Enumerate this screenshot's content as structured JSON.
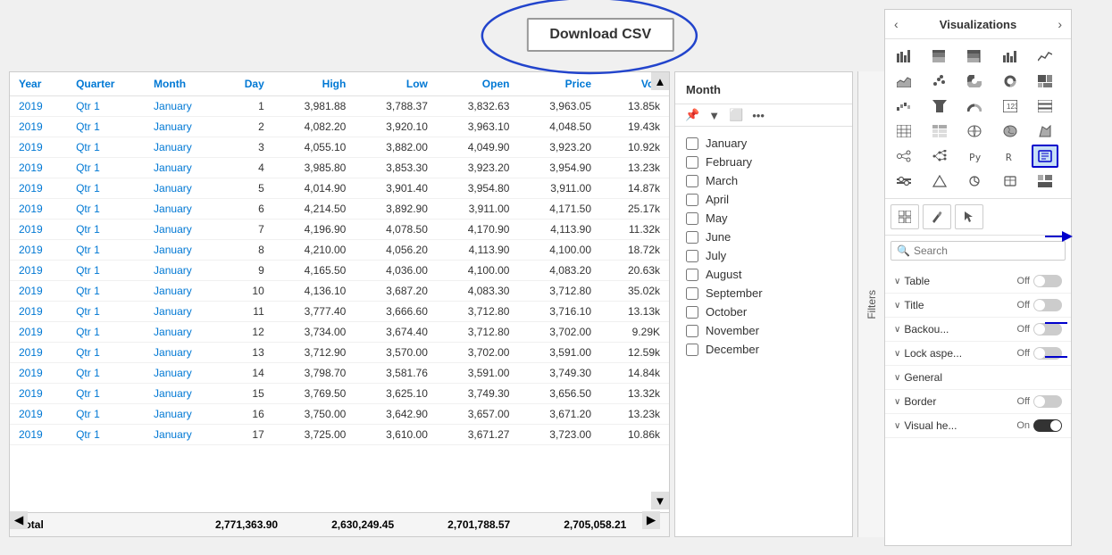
{
  "header": {
    "download_csv": "Download CSV"
  },
  "table": {
    "columns": [
      "Year",
      "Quarter",
      "Month",
      "Day",
      "High",
      "Low",
      "Open",
      "Price",
      "Vol."
    ],
    "rows": [
      [
        "2019",
        "Qtr 1",
        "January",
        "1",
        "3,981.88",
        "3,788.37",
        "3,832.63",
        "3,963.05",
        "13.85k"
      ],
      [
        "2019",
        "Qtr 1",
        "January",
        "2",
        "4,082.20",
        "3,920.10",
        "3,963.10",
        "4,048.50",
        "19.43k"
      ],
      [
        "2019",
        "Qtr 1",
        "January",
        "3",
        "4,055.10",
        "3,882.00",
        "4,049.90",
        "3,923.20",
        "10.92k"
      ],
      [
        "2019",
        "Qtr 1",
        "January",
        "4",
        "3,985.80",
        "3,853.30",
        "3,923.20",
        "3,954.90",
        "13.23k"
      ],
      [
        "2019",
        "Qtr 1",
        "January",
        "5",
        "4,014.90",
        "3,901.40",
        "3,954.80",
        "3,911.00",
        "14.87k"
      ],
      [
        "2019",
        "Qtr 1",
        "January",
        "6",
        "4,214.50",
        "3,892.90",
        "3,911.00",
        "4,171.50",
        "25.17k"
      ],
      [
        "2019",
        "Qtr 1",
        "January",
        "7",
        "4,196.90",
        "4,078.50",
        "4,170.90",
        "4,113.90",
        "11.32k"
      ],
      [
        "2019",
        "Qtr 1",
        "January",
        "8",
        "4,210.00",
        "4,056.20",
        "4,113.90",
        "4,100.00",
        "18.72k"
      ],
      [
        "2019",
        "Qtr 1",
        "January",
        "9",
        "4,165.50",
        "4,036.00",
        "4,100.00",
        "4,083.20",
        "20.63k"
      ],
      [
        "2019",
        "Qtr 1",
        "January",
        "10",
        "4,136.10",
        "3,687.20",
        "4,083.30",
        "3,712.80",
        "35.02k"
      ],
      [
        "2019",
        "Qtr 1",
        "January",
        "11",
        "3,777.40",
        "3,666.60",
        "3,712.80",
        "3,716.10",
        "13.13k"
      ],
      [
        "2019",
        "Qtr 1",
        "January",
        "12",
        "3,734.00",
        "3,674.40",
        "3,712.80",
        "3,702.00",
        "9.29K"
      ],
      [
        "2019",
        "Qtr 1",
        "January",
        "13",
        "3,712.90",
        "3,570.00",
        "3,702.00",
        "3,591.00",
        "12.59k"
      ],
      [
        "2019",
        "Qtr 1",
        "January",
        "14",
        "3,798.70",
        "3,581.76",
        "3,591.00",
        "3,749.30",
        "14.84k"
      ],
      [
        "2019",
        "Qtr 1",
        "January",
        "15",
        "3,769.50",
        "3,625.10",
        "3,749.30",
        "3,656.50",
        "13.32k"
      ],
      [
        "2019",
        "Qtr 1",
        "January",
        "16",
        "3,750.00",
        "3,642.90",
        "3,657.00",
        "3,671.20",
        "13.23k"
      ],
      [
        "2019",
        "Qtr 1",
        "January",
        "17",
        "3,725.00",
        "3,610.00",
        "3,671.27",
        "3,723.00",
        "10.86k"
      ]
    ],
    "footer": {
      "label": "Total",
      "high": "2,771,363.90",
      "low": "2,630,249.45",
      "open": "2,701,788.57",
      "price": "2,705,058.21"
    }
  },
  "filter_panel": {
    "title": "Month",
    "items": [
      "January",
      "February",
      "March",
      "April",
      "May",
      "June",
      "July",
      "August",
      "September",
      "October",
      "November",
      "December"
    ]
  },
  "filters_sidebar": {
    "label": "Filters"
  },
  "viz_panel": {
    "title": "Visualizations",
    "search_placeholder": "Search",
    "properties": [
      {
        "label": "Table",
        "state": "Off",
        "on": false
      },
      {
        "label": "Title",
        "state": "Off",
        "on": false
      },
      {
        "label": "Backou...",
        "state": "Off",
        "on": false
      },
      {
        "label": "Lock aspe...",
        "state": "Off",
        "on": false
      },
      {
        "label": "General",
        "state": "",
        "on": false,
        "section": true
      },
      {
        "label": "Border",
        "state": "Off",
        "on": false
      },
      {
        "label": "Visual he...",
        "state": "On",
        "on": true,
        "dark": true
      }
    ],
    "icon_rows": [
      [
        "bar-chart",
        "stacked-bar",
        "column-chart",
        "stacked-col",
        "line-chart"
      ],
      [
        "area-chart",
        "scatter",
        "pie-chart",
        "donut",
        "treemap"
      ],
      [
        "waterfall",
        "funnel",
        "gauge",
        "card",
        "multi-row-card"
      ],
      [
        "table-icon",
        "matrix",
        "map",
        "filled-map",
        "shape-map"
      ],
      [
        "key-influencer",
        "decomp-tree",
        "python",
        "r-visual",
        "custom1"
      ],
      [
        "custom2",
        "custom3",
        "custom4",
        "custom5",
        "highlighted-icon"
      ]
    ],
    "tools": [
      "grid-icon",
      "paint-icon",
      "cursor-icon"
    ]
  }
}
